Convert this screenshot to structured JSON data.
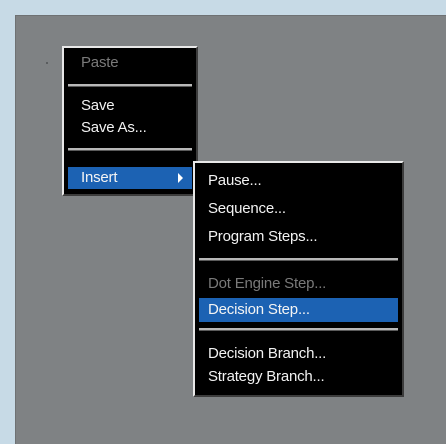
{
  "context_menu": {
    "items": [
      {
        "label": "Paste",
        "state": "disabled"
      },
      {
        "label": "Save",
        "state": "enabled"
      },
      {
        "label": "Save As...",
        "state": "enabled"
      },
      {
        "label": "Insert",
        "state": "highlighted",
        "submenu": true
      }
    ]
  },
  "insert_submenu": {
    "items": [
      {
        "label": "Pause...",
        "state": "enabled"
      },
      {
        "label": "Sequence...",
        "state": "enabled"
      },
      {
        "label": "Program Steps...",
        "state": "enabled"
      },
      {
        "label": "Dot Engine Step...",
        "state": "disabled"
      },
      {
        "label": "Decision Step...",
        "state": "highlighted"
      },
      {
        "label": "Decision Branch...",
        "state": "enabled"
      },
      {
        "label": "Strategy Branch...",
        "state": "enabled"
      }
    ]
  },
  "colors": {
    "highlight": "#1c62b3",
    "menu_background": "#000000",
    "workspace": "#7f8284",
    "frame": "#c7dae6"
  }
}
